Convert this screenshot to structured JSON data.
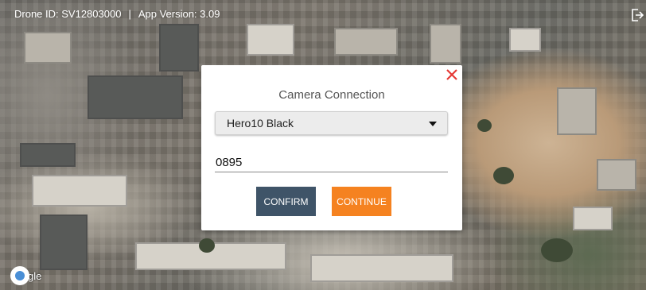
{
  "topbar": {
    "drone_id": "Drone ID: SV12803000",
    "separator": "|",
    "app_version": "App Version: 3.09",
    "exit_icon": "exit-icon"
  },
  "map": {
    "attribution": "gle",
    "logo_icon": "google-logo-icon"
  },
  "dialog": {
    "title": "Camera Connection",
    "close_icon": "close-icon",
    "camera_select": {
      "selected": "Hero10 Black",
      "icon": "chevron-down-icon"
    },
    "code_value": "0895",
    "confirm_label": "CONFIRM",
    "continue_label": "CONTINUE",
    "colors": {
      "close": "#e53935",
      "confirm": "#3f5468",
      "continue": "#f58220"
    }
  }
}
